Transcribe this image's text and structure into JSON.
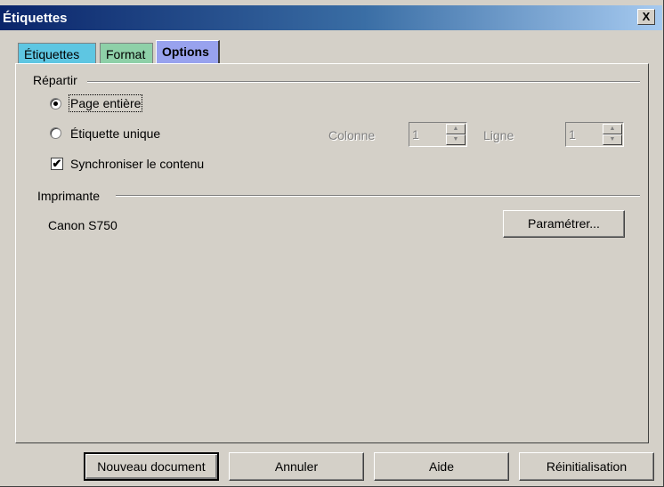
{
  "window": {
    "title": "Étiquettes",
    "close_label": "X"
  },
  "tabs": [
    {
      "label": "Étiquettes",
      "color": "#5ec6e2"
    },
    {
      "label": "Format",
      "color": "#8ed0a8"
    },
    {
      "label": "Options",
      "color": "#98a2ee",
      "selected": true
    }
  ],
  "distribute": {
    "group_label": "Répartir",
    "page_entiere": {
      "label": "Page entière",
      "checked": true
    },
    "etiquette_unique": {
      "label": "Étiquette unique",
      "checked": false
    },
    "colonne": {
      "label": "Colonne",
      "value": "1"
    },
    "ligne": {
      "label": "Ligne",
      "value": "1"
    },
    "synchroniser": {
      "label": "Synchroniser le contenu",
      "checked": true,
      "mark": "✔"
    }
  },
  "printer": {
    "group_label": "Imprimante",
    "name": "Canon S750",
    "setup_label": "Paramétrer..."
  },
  "footer": {
    "new_document": "Nouveau document",
    "cancel": "Annuler",
    "help": "Aide",
    "reset": "Réinitialisation"
  }
}
